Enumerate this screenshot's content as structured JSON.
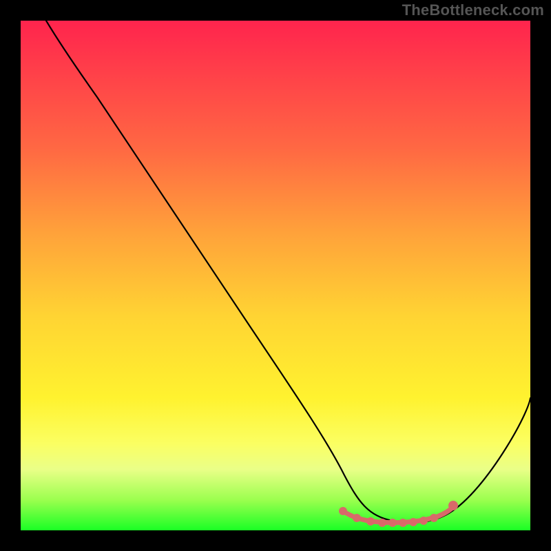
{
  "watermark": "TheBottleneck.com",
  "chart_data": {
    "type": "line",
    "title": "",
    "xlabel": "",
    "ylabel": "",
    "xlim": [
      0,
      100
    ],
    "ylim": [
      0,
      100
    ],
    "grid": false,
    "series": [
      {
        "name": "curve",
        "x": [
          5,
          10,
          15,
          20,
          25,
          30,
          35,
          40,
          45,
          50,
          55,
          60,
          63,
          66,
          70,
          74,
          78,
          81,
          84,
          88,
          92,
          96,
          100
        ],
        "y": [
          100,
          94,
          87,
          80,
          73,
          66,
          58,
          51,
          43,
          36,
          28,
          20,
          14,
          9,
          5,
          3,
          2,
          2,
          3,
          6,
          11,
          18,
          26
        ]
      }
    ],
    "flat_bottom_segment": {
      "x_start": 63,
      "x_end": 84,
      "y": 2
    },
    "flat_dots_x": [
      63,
      66,
      69,
      71,
      73,
      75,
      77,
      79,
      81,
      84
    ],
    "gradient_stops": [
      {
        "pos": 0,
        "color": "#ff244d"
      },
      {
        "pos": 25,
        "color": "#ff6843"
      },
      {
        "pos": 58,
        "color": "#ffd433"
      },
      {
        "pos": 83,
        "color": "#fbff62"
      },
      {
        "pos": 100,
        "color": "#1aff25"
      }
    ]
  }
}
